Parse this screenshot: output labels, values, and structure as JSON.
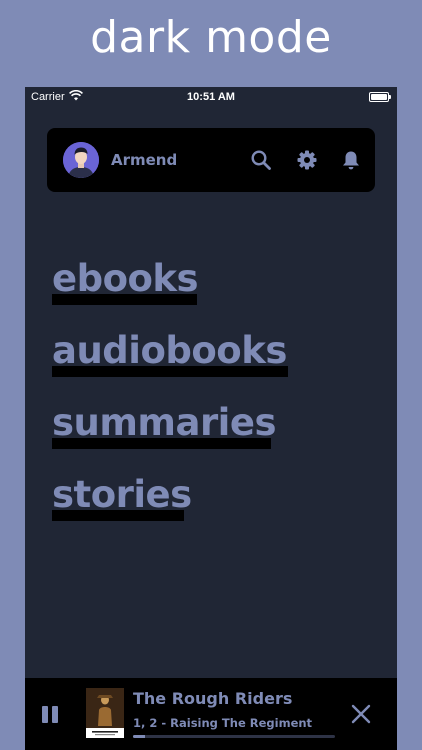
{
  "promo": {
    "title": "dark mode"
  },
  "status_bar": {
    "carrier": "Carrier",
    "time": "10:51 AM"
  },
  "header": {
    "username": "Armend",
    "icons": [
      "avatar",
      "search-icon",
      "gear-icon",
      "bell-icon"
    ]
  },
  "categories": [
    {
      "label": "ebooks"
    },
    {
      "label": "audiobooks"
    },
    {
      "label": "summaries"
    },
    {
      "label": "stories"
    }
  ],
  "player": {
    "title": "The Rough Riders",
    "chapter": "1, 2 - Raising The Regiment",
    "progress": 0.06,
    "icons": [
      "pause-icon",
      "close-icon"
    ]
  },
  "colors": {
    "background": "#7f8bb6",
    "screen": "#202635",
    "accent": "#7f8bb6",
    "card": "#000000"
  }
}
